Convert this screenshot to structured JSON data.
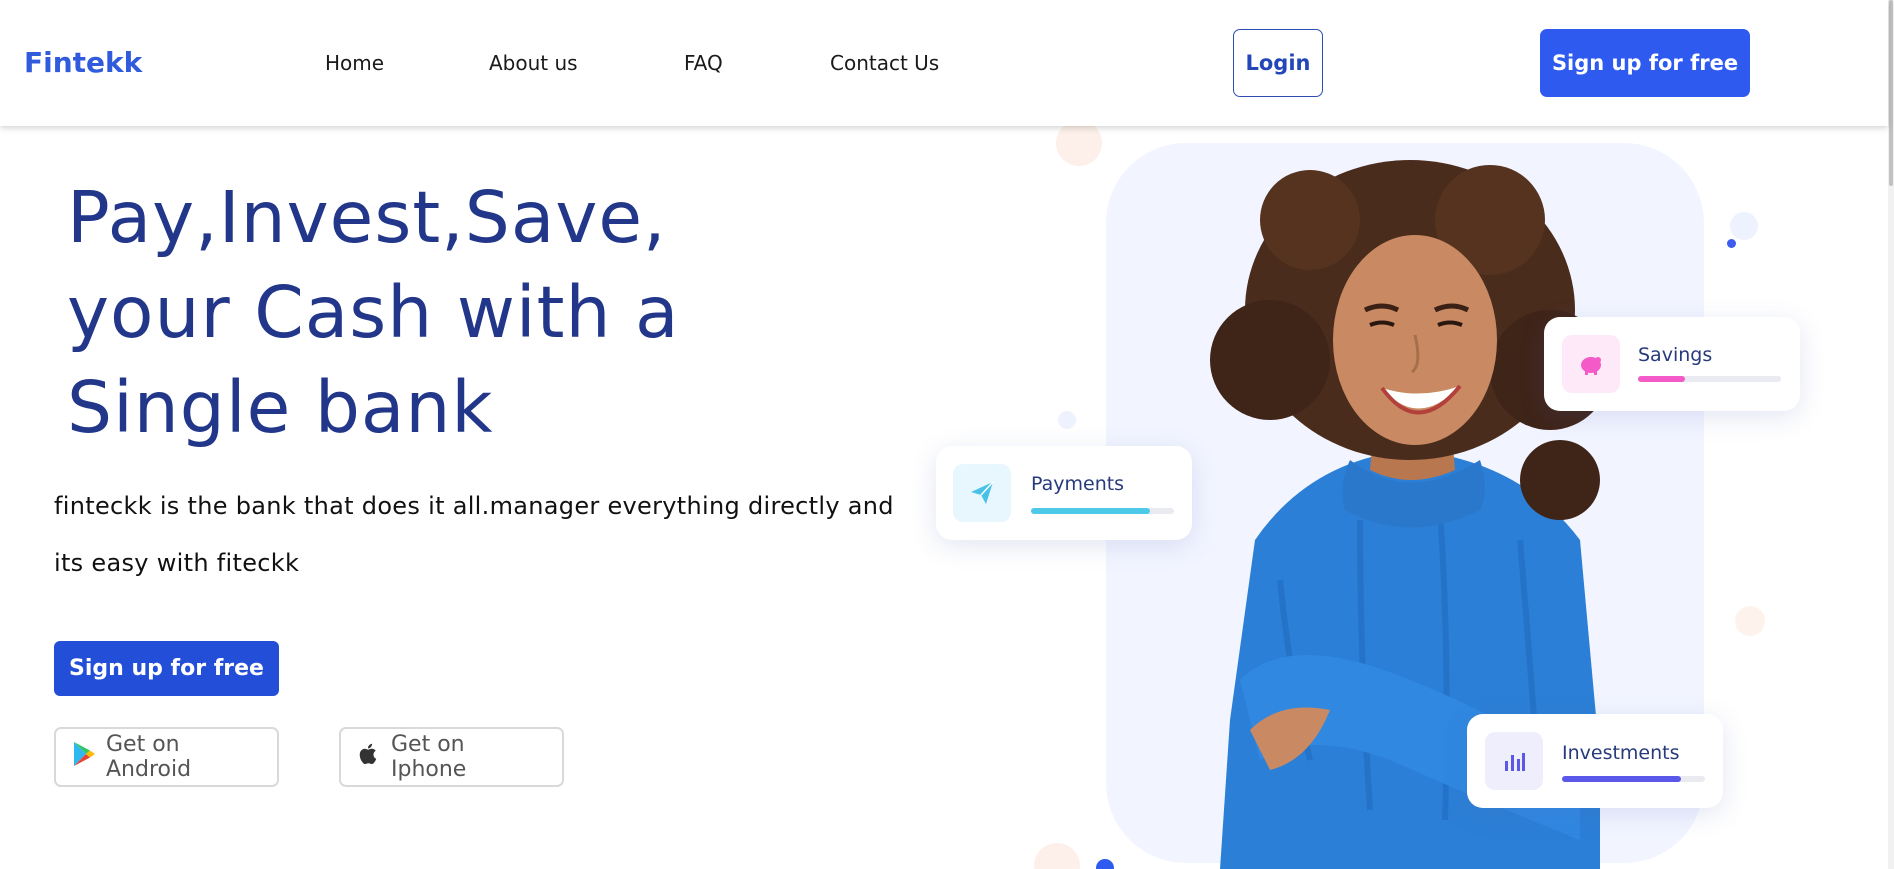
{
  "header": {
    "brand": "Fintekk",
    "nav": [
      "Home",
      "About us",
      "FAQ",
      "Contact Us"
    ],
    "login_label": "Login",
    "signup_label": "Sign up for free"
  },
  "hero": {
    "title_lines": [
      "Pay,Invest,Save,",
      "your Cash with a",
      "Single bank"
    ],
    "description_lines": [
      "finteckk is the bank that does it all.manager everything directly and",
      "its easy with fiteckk"
    ],
    "signup_label": "Sign up for free",
    "android_label": "Get on Android",
    "iphone_label": "Get on Iphone"
  },
  "cards": {
    "payments": {
      "label": "Payments",
      "progress": 0.83,
      "color": "#4fc9e8",
      "icon": "paper-plane-icon"
    },
    "savings": {
      "label": "Savings",
      "progress": 0.33,
      "color": "#f45bc8",
      "icon": "piggy-bank-icon"
    },
    "investments": {
      "label": "Investments",
      "progress": 0.83,
      "color": "#5a58e8",
      "icon": "bar-chart-icon"
    }
  },
  "colors": {
    "brand": "#2f5bdc",
    "primary_button": "#2f5aef",
    "hero_title": "#22378a"
  }
}
